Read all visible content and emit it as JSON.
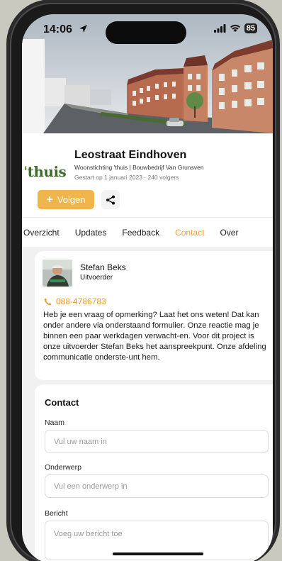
{
  "status_bar": {
    "time": "14:06",
    "battery": "85"
  },
  "project": {
    "logo_apostrophe": "'",
    "logo_text": "thuis",
    "title": "Leostraat Eindhoven",
    "organisation": "Woonstichting 'thuis | Bouwbedrijf Van Grunsven",
    "meta": "Gestart op 1 januari 2023 · 240 volgers",
    "follow_label": "Volgen",
    "follow_icon": "plus-icon",
    "share_icon": "share-icon"
  },
  "tabs": [
    {
      "label": "Overzicht",
      "active": false
    },
    {
      "label": "Updates",
      "active": false
    },
    {
      "label": "Feedback",
      "active": false
    },
    {
      "label": "Contact",
      "active": true
    },
    {
      "label": "Over",
      "active": false
    }
  ],
  "contact_card": {
    "name": "Stefan Beks",
    "role": "Uitvoerder",
    "phone": "088-4786783",
    "text": "Heb je een vraag of opmerking? Laat het ons weten! Dat kan onder andere via onderstaand formulier. Onze reactie mag je binnen een paar werkdagen verwacht-en. Voor dit project is onze uitvoerder Stefan Beks het aanspreekpunt. Onze afdeling communicatie onderste-unt hem."
  },
  "form": {
    "title": "Contact",
    "name_label": "Naam",
    "name_placeholder": "Vul uw naam in",
    "subject_label": "Onderwerp",
    "subject_placeholder": "Vul een onderwerp in",
    "message_label": "Bericht",
    "message_placeholder": "Voeg uw bericht toe"
  },
  "colors": {
    "accent": "#f0b54a",
    "accent_text": "#e9a43a",
    "logo": "#3f6b2b"
  }
}
